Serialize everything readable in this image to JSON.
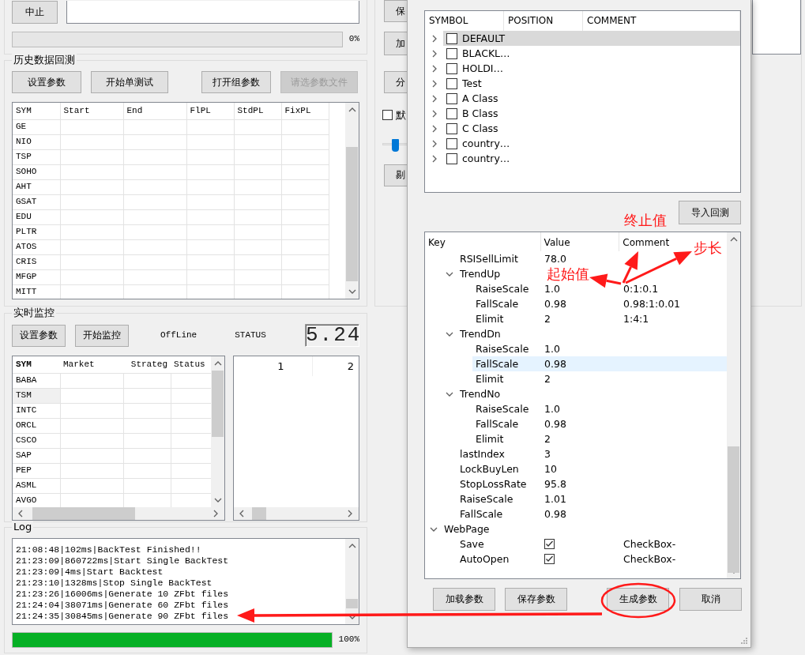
{
  "top_panel": {
    "stop_button": "中止",
    "progress": {
      "level": 0,
      "reading": "0%"
    }
  },
  "backtest": {
    "title": "历史数据回测",
    "buttons": [
      {
        "label": "设置参数",
        "disabled": false
      },
      {
        "label": "开始单测试",
        "disabled": false
      },
      {
        "label": "打开组参数",
        "disabled": false
      },
      {
        "label": "请选参数文件",
        "disabled": true
      }
    ],
    "table": {
      "columns": [
        "SYM",
        "Start",
        "End",
        "FlPL",
        "StdPL",
        "FixPL"
      ],
      "rows": [
        "GE",
        "NIO",
        "TSP",
        "SOHO",
        "AHT",
        "GSAT",
        "EDU",
        "PLTR",
        "ATOS",
        "CRIS",
        "MFGP",
        "MITT"
      ]
    }
  },
  "monitor": {
    "title": "实时监控",
    "buttons": [
      "设置参数",
      "开始监控"
    ],
    "connection": "OffLine",
    "status": "STATUS",
    "display": "5.24",
    "table": {
      "columns": [
        "SYM",
        "Market",
        "Strateg",
        "Status"
      ],
      "rows": [
        {
          "sym": "BABA",
          "selected": false
        },
        {
          "sym": "TSM",
          "selected": true
        },
        {
          "sym": "INTC",
          "selected": false
        },
        {
          "sym": "ORCL",
          "selected": false
        },
        {
          "sym": "CSCO",
          "selected": false
        },
        {
          "sym": "SAP",
          "selected": false
        },
        {
          "sym": "PEP",
          "selected": false
        },
        {
          "sym": "ASML",
          "selected": false
        },
        {
          "sym": "AVGO",
          "selected": false
        }
      ]
    },
    "grid": {
      "columns": [
        "1",
        "2"
      ]
    }
  },
  "log": {
    "title": "Log",
    "lines": [
      "21:08:48|102ms|BackTest Finished!!",
      "21:23:09|860722ms|Start Single BackTest",
      "21:23:09|4ms|Start Backtest",
      "21:23:10|1328ms|Stop Single BackTest",
      "21:23:26|16006ms|Generate 10 ZFbt files",
      "21:24:04|38071ms|Generate 60 ZFbt files",
      "21:24:35|30845ms|Generate 90 ZFbt files"
    ],
    "progress": {
      "level": 1,
      "reading": "100%"
    }
  },
  "side_controls": [
    {
      "kind": "button",
      "label": "保"
    },
    {
      "kind": "button",
      "label": "加"
    },
    {
      "kind": "button",
      "label": "分"
    },
    {
      "kind": "checkbox",
      "label": "默",
      "checked": false
    },
    {
      "kind": "slider",
      "level": 0.1
    },
    {
      "kind": "button",
      "label": "剔"
    }
  ],
  "dialog": {
    "symbols": {
      "columns": [
        "SYMBOL",
        "POSITION",
        "COMMENT"
      ],
      "rows": [
        {
          "label": "DEFAULT",
          "checked": false,
          "expanded": false,
          "selected": true
        },
        {
          "label": "BLACKL…",
          "checked": false,
          "expanded": false,
          "selected": false
        },
        {
          "label": "HOLDI…",
          "checked": false,
          "expanded": false,
          "selected": false
        },
        {
          "label": "Test",
          "checked": false,
          "expanded": false,
          "selected": false
        },
        {
          "label": "A Class",
          "checked": false,
          "expanded": false,
          "selected": false
        },
        {
          "label": "B Class",
          "checked": false,
          "expanded": false,
          "selected": false
        },
        {
          "label": "C Class",
          "checked": false,
          "expanded": false,
          "selected": false
        },
        {
          "label": "country…",
          "checked": false,
          "expanded": false,
          "selected": false
        },
        {
          "label": "country…",
          "checked": false,
          "expanded": false,
          "selected": false
        }
      ]
    },
    "import_button": "导入回测",
    "properties": {
      "columns": [
        "Key",
        "Value",
        "Comment"
      ],
      "rows": [
        {
          "children": [
            {
              "key": "RSISellLimit",
              "value": "78.0",
              "selected": false
            },
            {
              "key": "TrendUp",
              "expanded": true,
              "selected": false,
              "children": [
                {
                  "key": "RaiseScale",
                  "value": "1.0",
                  "comment": "0:1:0.1",
                  "selected": false
                },
                {
                  "key": "FallScale",
                  "value": "0.98",
                  "comment": "0.98:1:0.01",
                  "selected": false
                },
                {
                  "key": "Elimit",
                  "value": "2",
                  "comment": "1:4:1",
                  "selected": false
                }
              ]
            },
            {
              "key": "TrendDn",
              "expanded": true,
              "selected": false,
              "children": [
                {
                  "key": "RaiseScale",
                  "value": "1.0",
                  "selected": false
                },
                {
                  "key": "FallScale",
                  "value": "0.98",
                  "selected": true
                },
                {
                  "key": "Elimit",
                  "value": "2",
                  "selected": false
                }
              ]
            },
            {
              "key": "TrendNo",
              "expanded": true,
              "selected": false,
              "children": [
                {
                  "key": "RaiseScale",
                  "value": "1.0",
                  "selected": false
                },
                {
                  "key": "FallScale",
                  "value": "0.98",
                  "selected": false
                },
                {
                  "key": "Elimit",
                  "value": "2",
                  "selected": false
                }
              ]
            },
            {
              "key": "lastIndex",
              "value": "3",
              "selected": false
            },
            {
              "key": "LockBuyLen",
              "value": "10",
              "selected": false
            },
            {
              "key": "StopLossRate",
              "value": "95.8",
              "selected": false
            },
            {
              "key": "RaiseScale",
              "value": "1.01",
              "selected": false
            },
            {
              "key": "FallScale",
              "value": "0.98",
              "selected": false
            }
          ]
        },
        {
          "key": "WebPage",
          "expanded": true,
          "selected": false,
          "children": [
            {
              "key": "Save",
              "kind": "checkbox",
              "checked": true,
              "comment": "CheckBox-",
              "selected": false
            },
            {
              "key": "AutoOpen",
              "kind": "checkbox",
              "checked": true,
              "comment": "CheckBox-",
              "selected": false
            }
          ]
        }
      ]
    },
    "buttons": [
      "加载参数",
      "保存参数",
      "生成参数",
      "取消"
    ]
  },
  "annotations": [
    {
      "text": "终止值"
    },
    {
      "text": "起始值"
    },
    {
      "text": "步长"
    }
  ]
}
